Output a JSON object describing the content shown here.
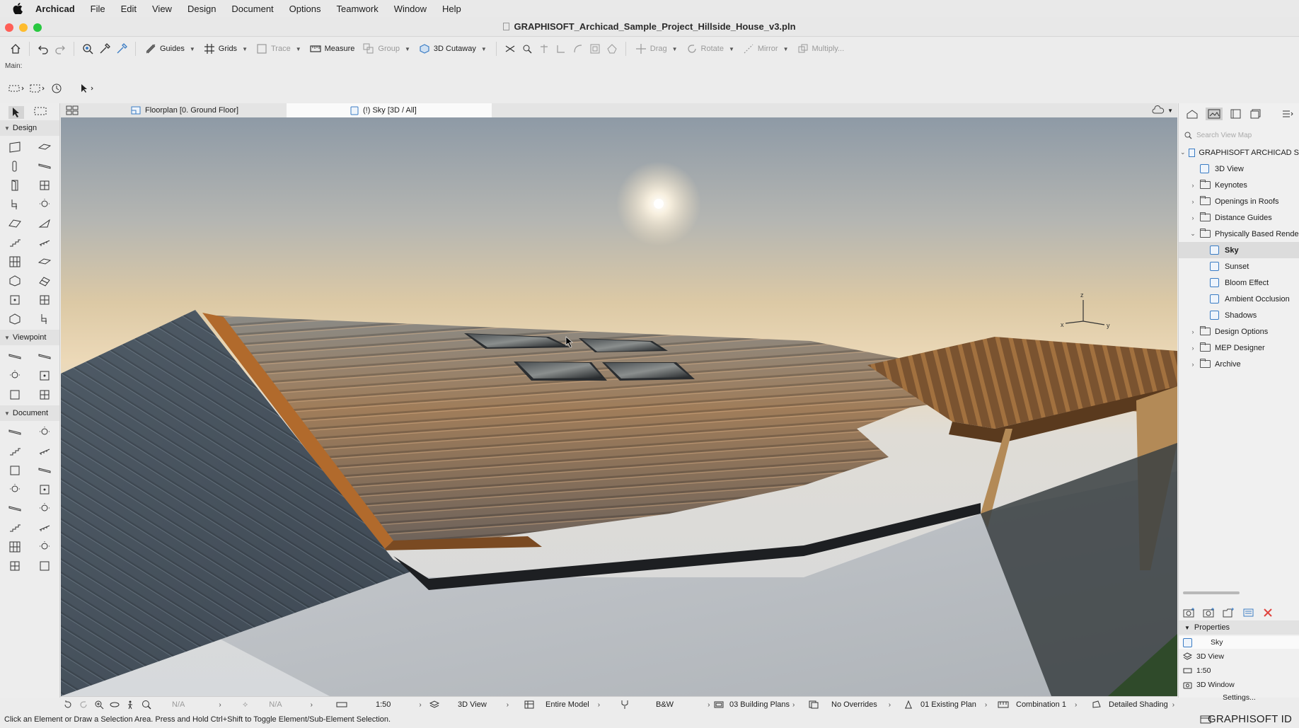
{
  "menubar": {
    "app_name": "Archicad",
    "items": [
      "File",
      "Edit",
      "View",
      "Design",
      "Document",
      "Options",
      "Teamwork",
      "Window",
      "Help"
    ]
  },
  "window": {
    "title": "GRAPHISOFT_Archicad_Sample_Project_Hillside_House_v3.pln"
  },
  "toolbar": {
    "guides": "Guides",
    "grids": "Grids",
    "trace": "Trace",
    "measure": "Measure",
    "group": "Group",
    "cutaway": "3D Cutaway",
    "drag": "Drag",
    "rotate": "Rotate",
    "mirror": "Mirror",
    "multiply": "Multiply..."
  },
  "main_label": "Main:",
  "toolbox": {
    "design": "Design",
    "viewpoint": "Viewpoint",
    "document": "Document"
  },
  "tabs": {
    "floorplan": "Floorplan [0. Ground Floor]",
    "sky": "(!) Sky [3D / All]"
  },
  "axes": {
    "x": "x",
    "y": "y",
    "z": "z"
  },
  "navigator": {
    "search_placeholder": "Search View Map",
    "root": "GRAPHISOFT ARCHICAD S",
    "items": [
      {
        "label": "3D View"
      },
      {
        "label": "Keynotes"
      },
      {
        "label": "Openings in Roofs"
      },
      {
        "label": "Distance Guides"
      },
      {
        "label": "Physically Based Rende"
      },
      {
        "label": "Sky"
      },
      {
        "label": "Sunset"
      },
      {
        "label": "Bloom Effect"
      },
      {
        "label": "Ambient Occlusion"
      },
      {
        "label": "Shadows"
      },
      {
        "label": "Design Options"
      },
      {
        "label": "MEP Designer"
      },
      {
        "label": "Archive"
      }
    ],
    "selected": "Sky"
  },
  "properties": {
    "header": "Properties",
    "name": "Sky",
    "view_type": "3D View",
    "scale": "1:50",
    "window": "3D Window",
    "settings": "Settings..."
  },
  "quick_options": {
    "na1": "N/A",
    "na2": "N/A",
    "scale": "1:50",
    "view": "3D View",
    "model": "Entire Model",
    "pen": "B&W",
    "layers": "03 Building Plans",
    "overrides": "No Overrides",
    "renovation": "01 Existing Plan",
    "combination": "Combination 1",
    "shading": "Detailed Shading"
  },
  "status": {
    "text": "Click an Element or Draw a Selection Area. Press and Hold Ctrl+Shift to Toggle Element/Sub-Element Selection.",
    "brand": "GRAPHISOFT ID"
  },
  "colors": {
    "accent_blue": "#3a7cc4",
    "close_red": "#e0443e",
    "traffic_red": "#ff5f57",
    "traffic_yellow": "#febc2e",
    "traffic_green": "#28c840"
  }
}
